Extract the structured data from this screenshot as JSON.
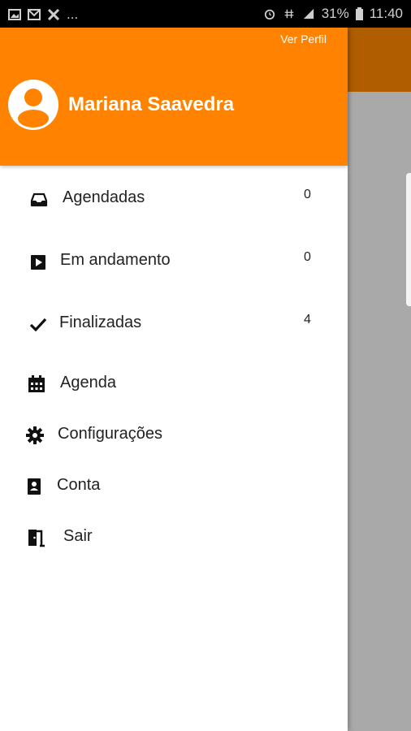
{
  "status_bar": {
    "left_more": "...",
    "battery": "31%",
    "time": "11:40"
  },
  "drawer": {
    "header": {
      "profile_link": "Ver Perfil",
      "user_name": "Mariana Saavedra",
      "avatar_icon": "account-circle-icon",
      "background_color": "#FF8300"
    },
    "items": [
      {
        "icon": "inbox-icon",
        "label": "Agendadas",
        "count": "0"
      },
      {
        "icon": "play-square-icon",
        "label": "Em andamento",
        "count": "0"
      },
      {
        "icon": "check-icon",
        "label": "Finalizadas",
        "count": "4"
      },
      {
        "icon": "calendar-icon",
        "label": "Agenda"
      },
      {
        "icon": "gear-icon",
        "label": "Configurações"
      },
      {
        "icon": "badge-icon",
        "label": "Conta"
      },
      {
        "icon": "exit-door-icon",
        "label": "Sair"
      }
    ]
  }
}
